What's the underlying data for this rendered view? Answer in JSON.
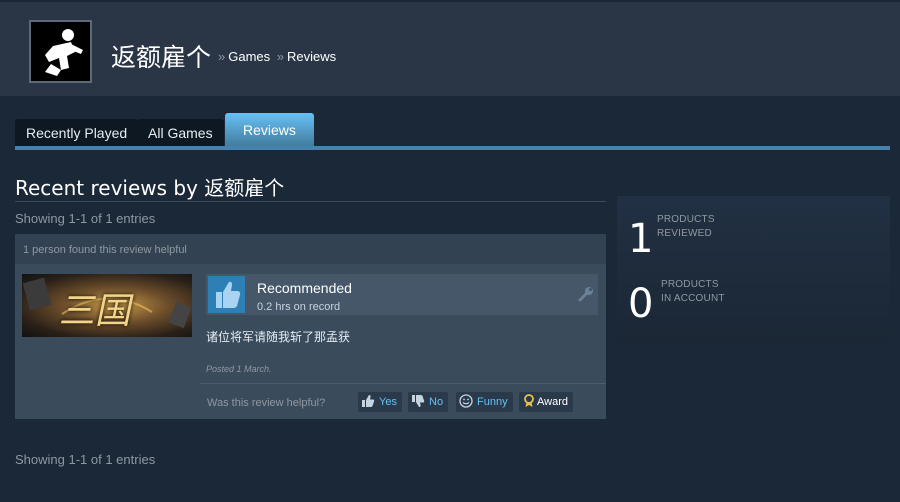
{
  "header": {
    "profile_name": "返额雇个",
    "breadcrumbs": [
      {
        "sep": "»",
        "label": "Games"
      },
      {
        "sep": "»",
        "label": "Reviews"
      }
    ]
  },
  "tabs": [
    {
      "label": "Recently Played",
      "active": false
    },
    {
      "label": "All Games",
      "active": false
    },
    {
      "label": "Reviews",
      "active": true
    }
  ],
  "main": {
    "title": "Recent reviews by 返额雇个",
    "showing_top": "Showing 1-1 of 1 entries",
    "showing_bottom": "Showing 1-1 of 1 entries"
  },
  "review": {
    "helpful_count_text": "1 person found this review helpful",
    "game_capsule_text": "三国",
    "verdict": "Recommended",
    "hours": "0.2 hrs on record",
    "body": "诸位将军请随我斩了那孟获",
    "posted": "Posted 1 March.",
    "helpful_question": "Was this review helpful?",
    "buttons": {
      "yes": "Yes",
      "no": "No",
      "funny": "Funny",
      "award": "Award"
    },
    "icons": {
      "thumb": "thumbs-up-icon",
      "wrench": "wrench-icon",
      "yes": "thumbs-up-icon",
      "no": "thumbs-down-icon",
      "funny": "smile-icon",
      "award": "award-ribbon-icon"
    }
  },
  "stats": {
    "products_reviewed_count": "1",
    "products_reviewed_label_1": "PRODUCTS",
    "products_reviewed_label_2": "REVIEWED",
    "products_in_account_count": "0",
    "products_in_account_label_1": "PRODUCTS",
    "products_in_account_label_2": "IN ACCOUNT"
  },
  "colors": {
    "background": "#1b2838",
    "header_bg": "#2a3646",
    "accent": "#67c1f5",
    "link": "#66c0f4"
  }
}
